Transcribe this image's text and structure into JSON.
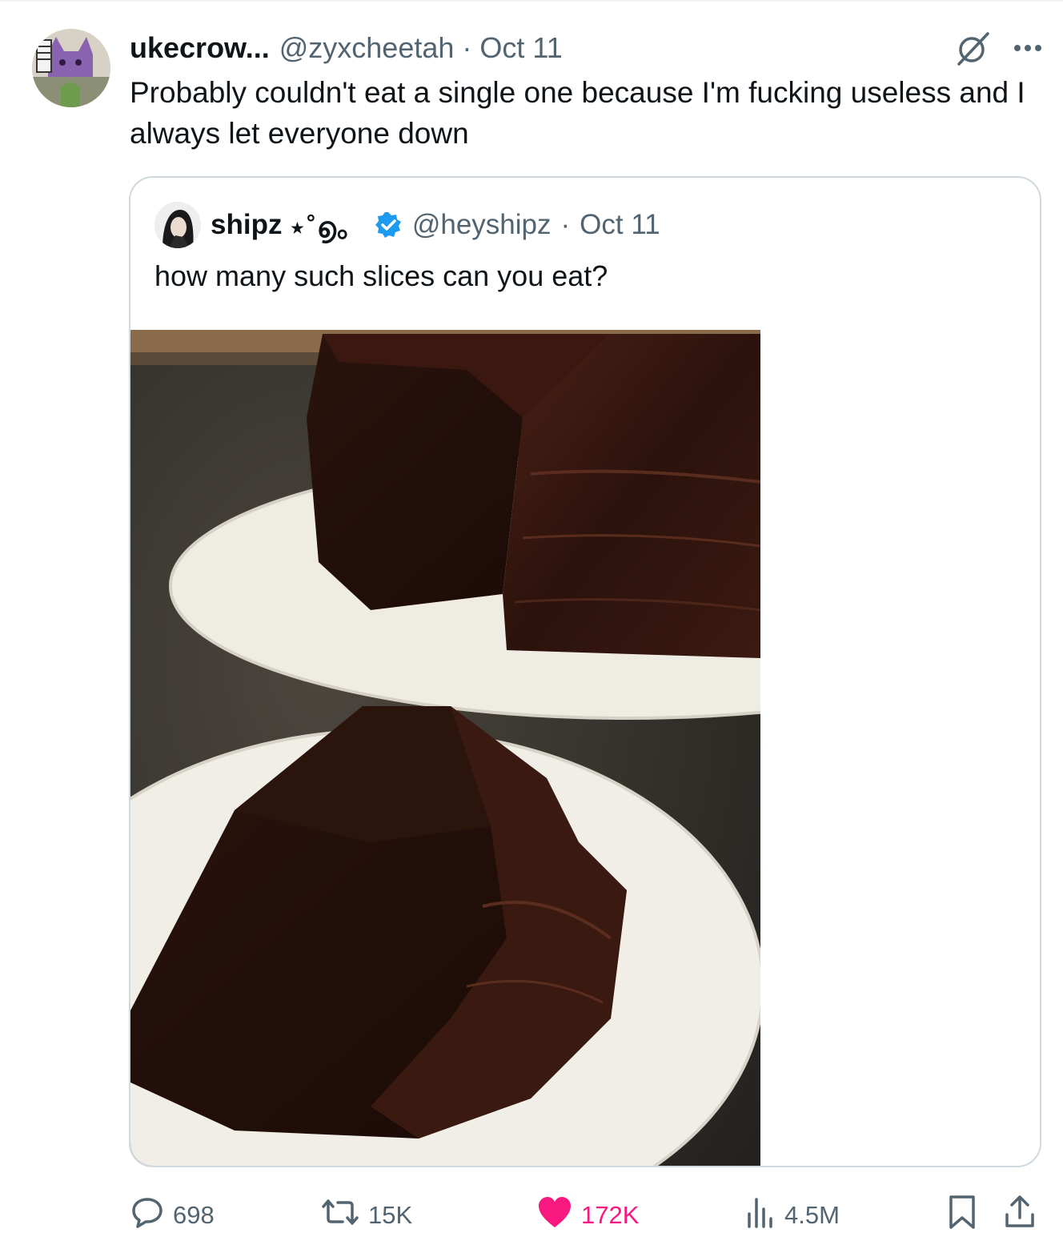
{
  "tweet": {
    "display_name": "ukecrow...",
    "handle": "@zyxcheetah",
    "separator": "·",
    "date": "Oct 11",
    "text": "Probably couldn't eat a single one because I'm fucking useless and I always let everyone down"
  },
  "quoted_tweet": {
    "display_name": "shipz",
    "name_decoration": "⋆˚൭。",
    "verified": true,
    "handle": "@heyshipz",
    "separator": "·",
    "date": "Oct 11",
    "text": "how many such slices can you eat?",
    "image": "chocolate-cake-photo"
  },
  "actions": {
    "replies": "698",
    "reposts": "15K",
    "likes": "172K",
    "views": "4.5M",
    "liked": true
  },
  "colors": {
    "secondary_text": "#536471",
    "like": "#f91880",
    "verified": "#1d9bf0",
    "border": "#cfd9de"
  },
  "icons": [
    "grok-icon",
    "more-icon",
    "reply-icon",
    "repost-icon",
    "like-icon",
    "views-icon",
    "bookmark-icon",
    "share-icon"
  ]
}
